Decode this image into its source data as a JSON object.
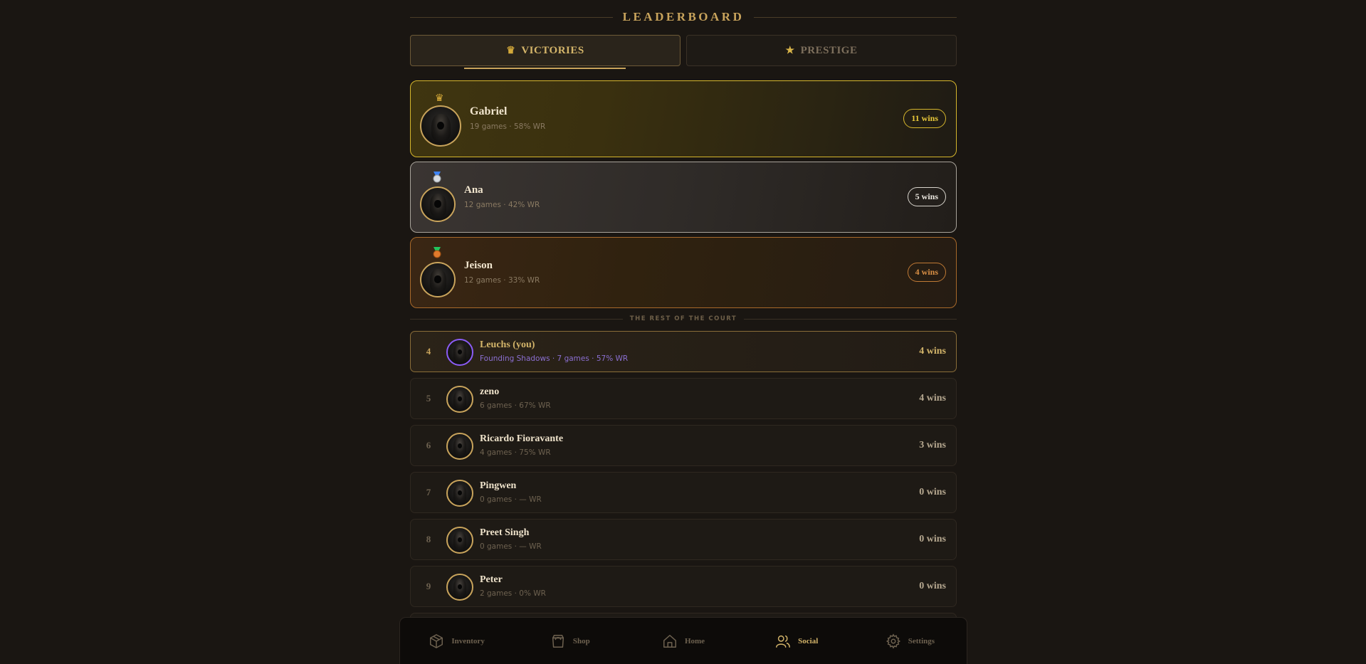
{
  "header": {
    "title": "LEADERBOARD"
  },
  "tabs": [
    {
      "label": "VICTORIES",
      "icon": "crown-icon",
      "active": true
    },
    {
      "label": "PRESTIGE",
      "icon": "star-icon",
      "active": false
    }
  ],
  "podium": [
    {
      "name": "Gabriel",
      "sub": "19 games · 58% WR",
      "wins": "11 wins",
      "badge": "crown-icon",
      "tier": "gold"
    },
    {
      "name": "Ana",
      "sub": "12 games · 42% WR",
      "wins": "5 wins",
      "badge": "silver-medal-icon",
      "tier": "silver"
    },
    {
      "name": "Jeison",
      "sub": "12 games · 33% WR",
      "wins": "4 wins",
      "badge": "bronze-medal-icon",
      "tier": "bronze"
    }
  ],
  "divider": "THE REST OF THE COURT",
  "rest": [
    {
      "rank": "4",
      "name": "Leuchs (you)",
      "sub": "Founding Shadows · 7 games · 57% WR",
      "wins": "4 wins",
      "you": true
    },
    {
      "rank": "5",
      "name": "zeno",
      "sub": "6 games · 67% WR",
      "wins": "4 wins"
    },
    {
      "rank": "6",
      "name": "Ricardo Fioravante",
      "sub": "4 games · 75% WR",
      "wins": "3 wins"
    },
    {
      "rank": "7",
      "name": "Pingwen",
      "sub": "0 games · — WR",
      "wins": "0 wins"
    },
    {
      "rank": "8",
      "name": "Preet Singh",
      "sub": "0 games · — WR",
      "wins": "0 wins"
    },
    {
      "rank": "9",
      "name": "Peter",
      "sub": "2 games · 0% WR",
      "wins": "0 wins"
    }
  ],
  "nav": [
    {
      "label": "Inventory",
      "icon": "box-icon",
      "active": false
    },
    {
      "label": "Shop",
      "icon": "shopping-bag-icon",
      "active": false
    },
    {
      "label": "Home",
      "icon": "home-icon",
      "active": false
    },
    {
      "label": "Social",
      "icon": "users-icon",
      "active": true
    },
    {
      "label": "Settings",
      "icon": "gear-icon",
      "active": false
    }
  ],
  "colors": {
    "gold": "#d6b62c",
    "silver": "#a8a39a",
    "bronze": "#a8692a",
    "accent": "#c9a45c",
    "you": "#8b5cf6",
    "background": "#1a1612"
  }
}
